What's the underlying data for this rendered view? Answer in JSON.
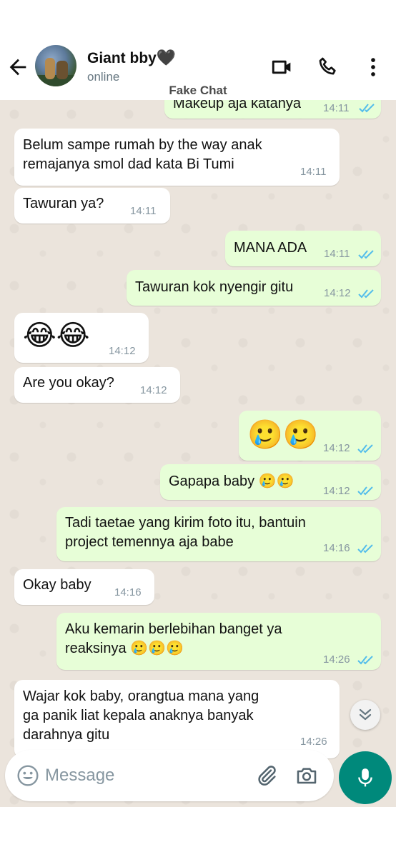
{
  "header": {
    "contact_name": "Giant bby",
    "contact_emoji": "🖤",
    "status": "online"
  },
  "watermark": "Fake Chat",
  "messages": [
    {
      "dir": "out",
      "text": "Makeup aja katanya",
      "time": "14:11",
      "read": true
    },
    {
      "dir": "in",
      "text": "Belum sampe rumah by the way anak\nremajanya smol dad kata Bi Tumi",
      "time": "14:11"
    },
    {
      "dir": "in",
      "text": "Tawuran ya?",
      "time": "14:11"
    },
    {
      "dir": "out",
      "text": "MANA ADA",
      "time": "14:11",
      "read": true
    },
    {
      "dir": "out",
      "text": "Tawuran kok nyengir gitu",
      "time": "14:12",
      "read": true
    },
    {
      "dir": "in",
      "text": "😂😂",
      "time": "14:12"
    },
    {
      "dir": "in",
      "text": "Are you okay?",
      "time": "14:12"
    },
    {
      "dir": "out",
      "text": "🥲🥲",
      "time": "14:12",
      "read": true
    },
    {
      "dir": "out",
      "text": "Gapapa baby 🥲🥲",
      "time": "14:12",
      "read": true
    },
    {
      "dir": "out",
      "text": "Tadi taetae yang kirim foto itu, bantuin\nproject temennya aja babe",
      "time": "14:16",
      "read": true
    },
    {
      "dir": "in",
      "text": "Okay baby",
      "time": "14:16"
    },
    {
      "dir": "out",
      "text": "Aku kemarin berlebihan banget ya\nreaksinya 🥲🥲🥲",
      "time": "14:26",
      "read": true
    },
    {
      "dir": "in",
      "text": "Wajar kok baby, orangtua mana yang\nga panik liat kepala anaknya banyak\ndarahnya gitu",
      "time": "14:26"
    }
  ],
  "composer": {
    "placeholder": "Message"
  },
  "colors": {
    "outgoing_bubble": "#e7fed7",
    "incoming_bubble": "#ffffff",
    "read_ticks": "#53bdeb",
    "accent": "#00897b",
    "chat_background": "#ebe4dc"
  },
  "icons": {
    "back": "arrow-left-icon",
    "video": "video-camera-icon",
    "call": "phone-icon",
    "more": "more-vertical-icon",
    "emoji": "emoji-icon",
    "attach": "paperclip-icon",
    "camera": "camera-icon",
    "mic": "microphone-icon",
    "scroll": "double-chevron-down-icon"
  }
}
